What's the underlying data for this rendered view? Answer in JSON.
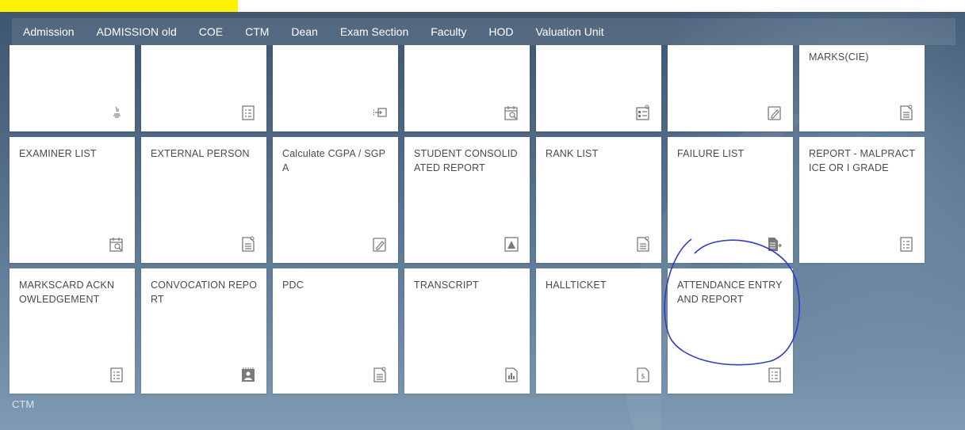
{
  "nav": {
    "tabs": [
      {
        "label": "Admission"
      },
      {
        "label": "ADMISSION old"
      },
      {
        "label": "COE",
        "active": true
      },
      {
        "label": "CTM"
      },
      {
        "label": "Dean"
      },
      {
        "label": "Exam Section"
      },
      {
        "label": "Faculty"
      },
      {
        "label": "HOD"
      },
      {
        "label": "Valuation Unit"
      }
    ]
  },
  "row1": [
    {
      "label": "",
      "icon": "java-icon"
    },
    {
      "label": "",
      "icon": "checklist-icon"
    },
    {
      "label": "",
      "icon": "import-icon"
    },
    {
      "label": "",
      "icon": "calendar-search-icon"
    },
    {
      "label": "",
      "icon": "report-icon"
    },
    {
      "label": "",
      "icon": "edit-icon"
    },
    {
      "label": "MARKS(CIE)",
      "icon": "document-icon"
    }
  ],
  "row2": [
    {
      "label": "EXAMINER LIST",
      "icon": "calendar-search-icon"
    },
    {
      "label": "EXTERNAL PERSON",
      "icon": "document-icon"
    },
    {
      "label": "Calculate CGPA / SGPA",
      "icon": "edit-icon"
    },
    {
      "label": "STUDENT CONSOLIDATED REPORT",
      "icon": "warning-doc-icon"
    },
    {
      "label": "RANK LIST",
      "icon": "document-icon"
    },
    {
      "label": "FAILURE LIST",
      "icon": "document-forward-icon"
    },
    {
      "label": "REPORT - MALPRACTICE OR I GRADE",
      "icon": "checklist-icon"
    }
  ],
  "row3": [
    {
      "label": "MARKSCARD ACKNOWLEDGEMENT",
      "icon": "checklist-icon"
    },
    {
      "label": "CONVOCATION REPORT",
      "icon": "id-card-icon"
    },
    {
      "label": "PDC",
      "icon": "document-icon"
    },
    {
      "label": "TRANSCRIPT",
      "icon": "chart-doc-icon"
    },
    {
      "label": "HALLTICKET",
      "icon": "dollar-doc-icon"
    },
    {
      "label": "ATTENDANCE ENTRY AND REPORT",
      "icon": "checklist-icon"
    }
  ],
  "footer": {
    "label": "CTM"
  },
  "colors": {
    "accent": "#2f3cc8",
    "shell": "#516b85"
  }
}
